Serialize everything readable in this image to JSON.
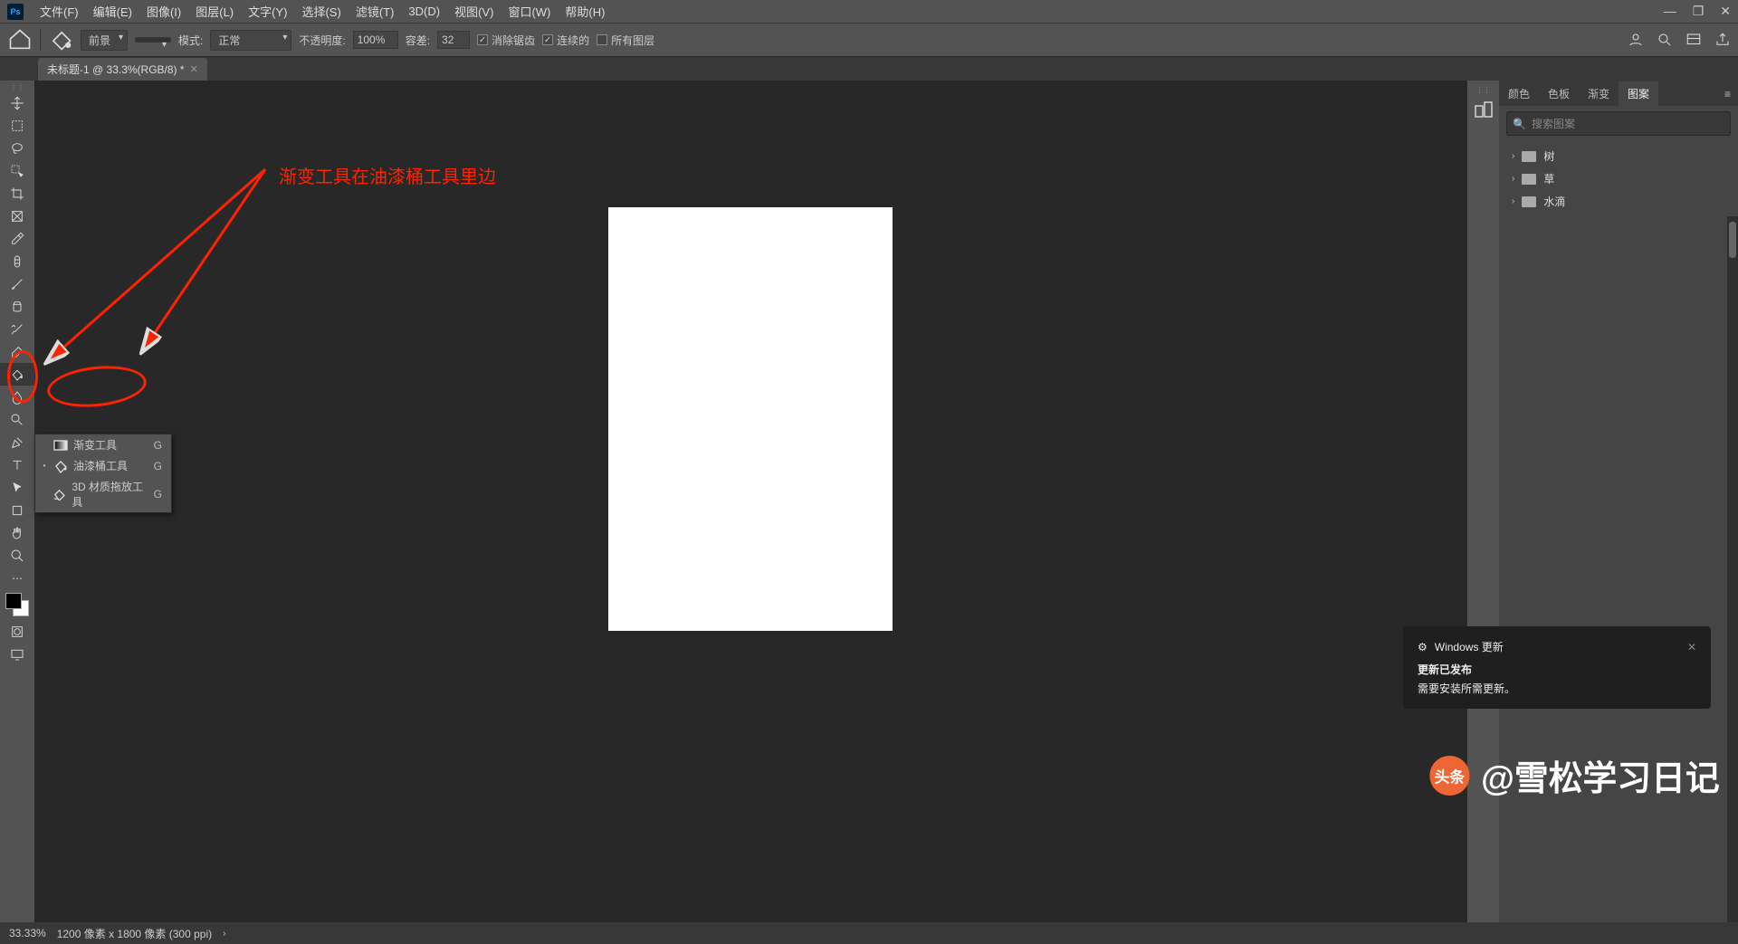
{
  "menu": {
    "items": [
      "文件(F)",
      "编辑(E)",
      "图像(I)",
      "图层(L)",
      "文字(Y)",
      "选择(S)",
      "滤镜(T)",
      "3D(D)",
      "视图(V)",
      "窗口(W)",
      "帮助(H)"
    ]
  },
  "options": {
    "fill_select": "前景",
    "mode_label": "模式:",
    "mode_value": "正常",
    "opacity_label": "不透明度:",
    "opacity_value": "100%",
    "tolerance_label": "容差:",
    "tolerance_value": "32",
    "antialias": "消除锯齿",
    "contiguous": "连续的",
    "all_layers": "所有图层"
  },
  "doc": {
    "tab": "未标题-1 @ 33.3%(RGB/8) *"
  },
  "flyout": {
    "items": [
      {
        "label": "渐变工具",
        "shortcut": "G",
        "active": false
      },
      {
        "label": "油漆桶工具",
        "shortcut": "G",
        "active": true
      },
      {
        "label": "3D 材质拖放工具",
        "shortcut": "G",
        "active": false
      }
    ]
  },
  "annotation": {
    "text": "渐变工具在油漆桶工具里边"
  },
  "panelTabs": [
    "颜色",
    "色板",
    "渐变",
    "图案"
  ],
  "panel": {
    "search_placeholder": "搜索图案",
    "folders": [
      "树",
      "草",
      "水滴"
    ]
  },
  "status": {
    "zoom": "33.33%",
    "doc": "1200 像素 x 1800 像素 (300 ppi)"
  },
  "notification": {
    "app": "Windows 更新",
    "title": "更新已发布",
    "body": "需要安装所需更新。"
  },
  "watermark": {
    "badge": "头条",
    "text": "@雪松学习日记"
  }
}
